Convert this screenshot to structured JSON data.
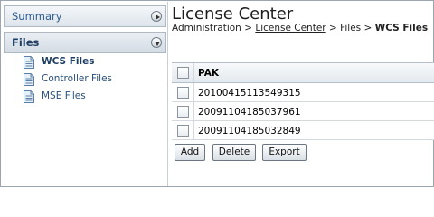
{
  "sidebar": {
    "summary_label": "Summary",
    "files_label": "Files",
    "items": [
      {
        "label": "WCS Files",
        "active": true
      },
      {
        "label": "Controller Files",
        "active": false
      },
      {
        "label": "MSE Files",
        "active": false
      }
    ]
  },
  "header": {
    "title": "License Center",
    "breadcrumb": {
      "root": "Administration",
      "sep1": ">",
      "link": "License Center",
      "sep2": ">",
      "mid": "Files",
      "sep3": ">",
      "current": "WCS Files"
    }
  },
  "table": {
    "columns": [
      "PAK"
    ],
    "rows": [
      {
        "pak": "20100415113549315"
      },
      {
        "pak": "20091104185037961"
      },
      {
        "pak": "20091104185032849"
      }
    ]
  },
  "toolbar": {
    "add_label": "Add",
    "delete_label": "Delete",
    "export_label": "Export"
  },
  "icons": {
    "summary_toggle": "right-arrow-circle-icon",
    "files_toggle": "down-arrow-circle-icon",
    "file": "document-icon"
  }
}
